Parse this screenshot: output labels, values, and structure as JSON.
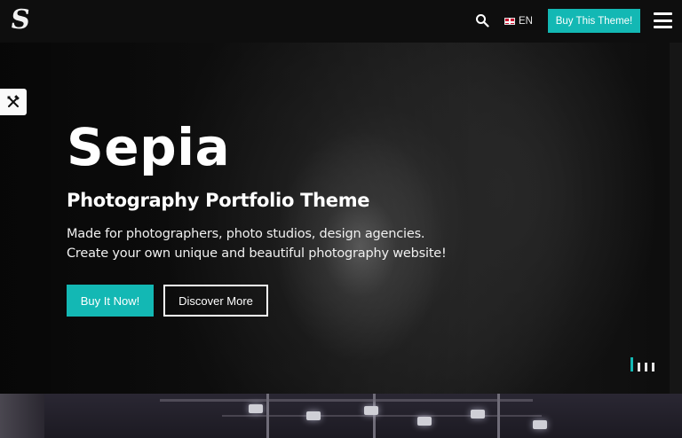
{
  "header": {
    "logo_glyph": "S",
    "search_icon": "search-icon",
    "language": {
      "flag_icon": "uk-flag-icon",
      "code": "EN"
    },
    "buy_theme_label": "Buy This Theme!",
    "menu_icon": "hamburger-menu-icon"
  },
  "hero": {
    "tools_icon": "tools-icon",
    "title": "Sepia",
    "subtitle": "Photography Portfolio Theme",
    "description_line1": "Made for photographers, photo studios, design agencies.",
    "description_line2": "Create your own unique and beautiful photography website!",
    "primary_button": "Buy It Now!",
    "secondary_button": "Discover More",
    "slides": {
      "count": 4,
      "active_index": 0
    }
  },
  "colors": {
    "accent": "#13b8b4",
    "header_bg": "#0e0e0e",
    "page_bg": "#141414",
    "text": "#ffffff"
  }
}
